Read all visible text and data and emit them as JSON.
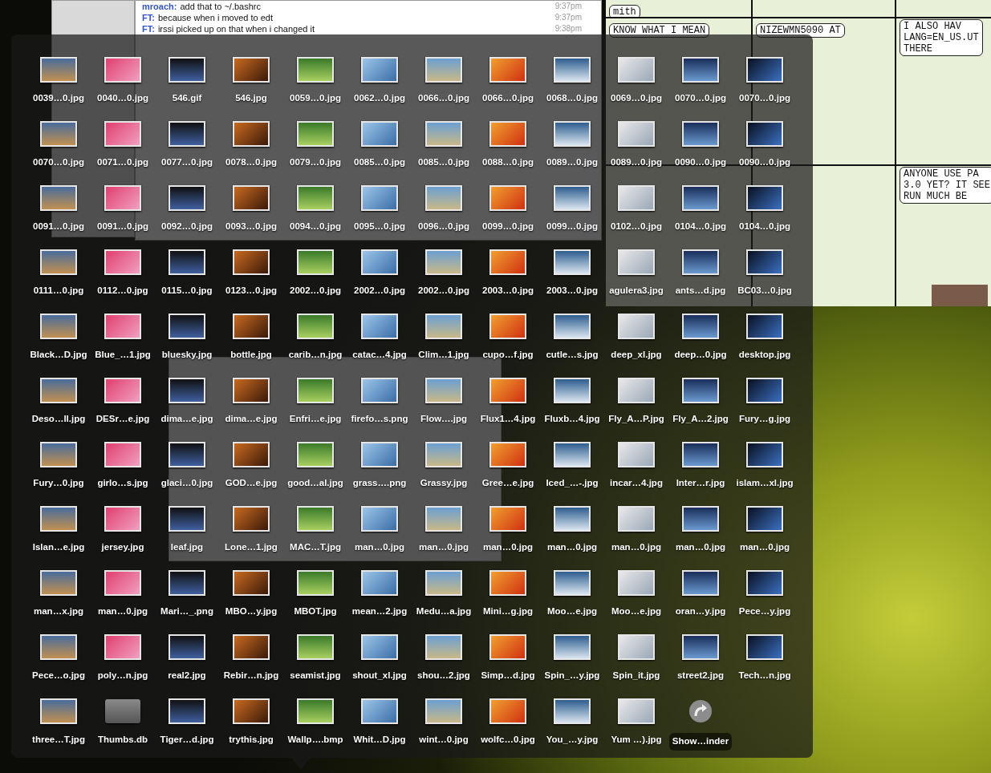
{
  "chat_window": {
    "lines": [
      {
        "nick": "mroach:",
        "text": "add that to ~/.bashrc",
        "time": "9:37pm"
      },
      {
        "nick": "FT:",
        "text": "because when i moved to edt",
        "time": "9:37pm"
      },
      {
        "nick": "FT:",
        "text": "irssi picked up on that when i changed it",
        "time": "9:38pm"
      }
    ]
  },
  "comic": {
    "bubbles": [
      {
        "lines": [
          "mith"
        ]
      },
      {
        "lines": [
          "KNOW WHAT I MEAN"
        ]
      },
      {
        "lines": [
          "NIZEWMN5090 AT"
        ]
      },
      {
        "lines": [
          "I ALSO HAV",
          "LANG=EN_US.UT",
          "THERE"
        ]
      },
      {
        "lines": [
          "ANYONE USE PA",
          "3.0 YET? IT SEE",
          "RUN MUCH BE"
        ]
      }
    ]
  },
  "stack": {
    "items": [
      {
        "label": "0039…0.jpg",
        "kind": "image"
      },
      {
        "label": "0040…0.jpg",
        "kind": "image"
      },
      {
        "label": "546.gif",
        "kind": "image"
      },
      {
        "label": "546.jpg",
        "kind": "image"
      },
      {
        "label": "0059…0.jpg",
        "kind": "image"
      },
      {
        "label": "0062…0.jpg",
        "kind": "image"
      },
      {
        "label": "0066…0.jpg",
        "kind": "image"
      },
      {
        "label": "0066…0.jpg",
        "kind": "image"
      },
      {
        "label": "0068…0.jpg",
        "kind": "image"
      },
      {
        "label": "0069…0.jpg",
        "kind": "image"
      },
      {
        "label": "0070…0.jpg",
        "kind": "image"
      },
      {
        "label": "0070…0.jpg",
        "kind": "image"
      },
      {
        "label": "0070…0.jpg",
        "kind": "image"
      },
      {
        "label": "0071…0.jpg",
        "kind": "image"
      },
      {
        "label": "0077…0.jpg",
        "kind": "image"
      },
      {
        "label": "0078…0.jpg",
        "kind": "image"
      },
      {
        "label": "0079…0.jpg",
        "kind": "image"
      },
      {
        "label": "0085…0.jpg",
        "kind": "image"
      },
      {
        "label": "0085…0.jpg",
        "kind": "image"
      },
      {
        "label": "0088…0.jpg",
        "kind": "image"
      },
      {
        "label": "0089…0.jpg",
        "kind": "image"
      },
      {
        "label": "0089…0.jpg",
        "kind": "image"
      },
      {
        "label": "0090…0.jpg",
        "kind": "image"
      },
      {
        "label": "0090…0.jpg",
        "kind": "image"
      },
      {
        "label": "0091…0.jpg",
        "kind": "image"
      },
      {
        "label": "0091…0.jpg",
        "kind": "image"
      },
      {
        "label": "0092…0.jpg",
        "kind": "image"
      },
      {
        "label": "0093…0.jpg",
        "kind": "image"
      },
      {
        "label": "0094…0.jpg",
        "kind": "image"
      },
      {
        "label": "0095…0.jpg",
        "kind": "image"
      },
      {
        "label": "0096…0.jpg",
        "kind": "image"
      },
      {
        "label": "0099…0.jpg",
        "kind": "image"
      },
      {
        "label": "0099…0.jpg",
        "kind": "image"
      },
      {
        "label": "0102…0.jpg",
        "kind": "image"
      },
      {
        "label": "0104…0.jpg",
        "kind": "image"
      },
      {
        "label": "0104…0.jpg",
        "kind": "image"
      },
      {
        "label": "0111…0.jpg",
        "kind": "image"
      },
      {
        "label": "0112…0.jpg",
        "kind": "image"
      },
      {
        "label": "0115…0.jpg",
        "kind": "image"
      },
      {
        "label": "0123…0.jpg",
        "kind": "image"
      },
      {
        "label": "2002…0.jpg",
        "kind": "image"
      },
      {
        "label": "2002…0.jpg",
        "kind": "image"
      },
      {
        "label": "2002…0.jpg",
        "kind": "image"
      },
      {
        "label": "2003…0.jpg",
        "kind": "image"
      },
      {
        "label": "2003…0.jpg",
        "kind": "image"
      },
      {
        "label": "agulera3.jpg",
        "kind": "image"
      },
      {
        "label": "ants…d.jpg",
        "kind": "image"
      },
      {
        "label": "BC03…0.jpg",
        "kind": "image"
      },
      {
        "label": "Black…D.jpg",
        "kind": "image"
      },
      {
        "label": "Blue_…1.jpg",
        "kind": "image"
      },
      {
        "label": "bluesky.jpg",
        "kind": "image"
      },
      {
        "label": "bottle.jpg",
        "kind": "image"
      },
      {
        "label": "carib…n.jpg",
        "kind": "image"
      },
      {
        "label": "catac…4.jpg",
        "kind": "image"
      },
      {
        "label": "Clim…1.jpg",
        "kind": "image"
      },
      {
        "label": "cupo…f.jpg",
        "kind": "image"
      },
      {
        "label": "cutle…s.jpg",
        "kind": "image"
      },
      {
        "label": "deep_xl.jpg",
        "kind": "image"
      },
      {
        "label": "deep…0.jpg",
        "kind": "image"
      },
      {
        "label": "desktop.jpg",
        "kind": "image"
      },
      {
        "label": "Deso…ll.jpg",
        "kind": "image"
      },
      {
        "label": "DESr…e.jpg",
        "kind": "image"
      },
      {
        "label": "dima…e.jpg",
        "kind": "image"
      },
      {
        "label": "dima…e.jpg",
        "kind": "image"
      },
      {
        "label": "Enfri…e.jpg",
        "kind": "image"
      },
      {
        "label": "firefo…s.png",
        "kind": "image"
      },
      {
        "label": "Flow….jpg",
        "kind": "image"
      },
      {
        "label": "Flux1…4.jpg",
        "kind": "image"
      },
      {
        "label": "Fluxb…4.jpg",
        "kind": "image"
      },
      {
        "label": "Fly_A…P.jpg",
        "kind": "image"
      },
      {
        "label": "Fly_A…2.jpg",
        "kind": "image"
      },
      {
        "label": "Fury…g.jpg",
        "kind": "image"
      },
      {
        "label": "Fury…0.jpg",
        "kind": "image"
      },
      {
        "label": "girlo…s.jpg",
        "kind": "image"
      },
      {
        "label": "glaci…0.jpg",
        "kind": "image"
      },
      {
        "label": "GOD…e.jpg",
        "kind": "image"
      },
      {
        "label": "good…al.jpg",
        "kind": "image"
      },
      {
        "label": "grass….png",
        "kind": "image"
      },
      {
        "label": "Grassy.jpg",
        "kind": "image"
      },
      {
        "label": "Gree…e.jpg",
        "kind": "image"
      },
      {
        "label": "Iced_…-.jpg",
        "kind": "image"
      },
      {
        "label": "incar…4.jpg",
        "kind": "image"
      },
      {
        "label": "Inter…r.jpg",
        "kind": "image"
      },
      {
        "label": "islam…xl.jpg",
        "kind": "image"
      },
      {
        "label": "Islan…e.jpg",
        "kind": "image"
      },
      {
        "label": "jersey.jpg",
        "kind": "image"
      },
      {
        "label": "leaf.jpg",
        "kind": "image"
      },
      {
        "label": "Lone…1.jpg",
        "kind": "image"
      },
      {
        "label": "MAC…T.jpg",
        "kind": "image"
      },
      {
        "label": "man…0.jpg",
        "kind": "image"
      },
      {
        "label": "man…0.jpg",
        "kind": "image"
      },
      {
        "label": "man…0.jpg",
        "kind": "image"
      },
      {
        "label": "man…0.jpg",
        "kind": "image"
      },
      {
        "label": "man…0.jpg",
        "kind": "image"
      },
      {
        "label": "man…0.jpg",
        "kind": "image"
      },
      {
        "label": "man…0.jpg",
        "kind": "image"
      },
      {
        "label": "man…x.jpg",
        "kind": "image"
      },
      {
        "label": "man…0.jpg",
        "kind": "image"
      },
      {
        "label": "Mari…_.png",
        "kind": "image"
      },
      {
        "label": "MBO…y.jpg",
        "kind": "image"
      },
      {
        "label": "MBOT.jpg",
        "kind": "image"
      },
      {
        "label": "mean…2.jpg",
        "kind": "image"
      },
      {
        "label": "Medu…a.jpg",
        "kind": "image"
      },
      {
        "label": "Mini…g.jpg",
        "kind": "image"
      },
      {
        "label": "Moo…e.jpg",
        "kind": "image"
      },
      {
        "label": "Moo…e.jpg",
        "kind": "image"
      },
      {
        "label": "oran…y.jpg",
        "kind": "image"
      },
      {
        "label": "Pece…y.jpg",
        "kind": "image"
      },
      {
        "label": "Pece…o.jpg",
        "kind": "image"
      },
      {
        "label": "poly…n.jpg",
        "kind": "image"
      },
      {
        "label": "real2.jpg",
        "kind": "image"
      },
      {
        "label": "Rebir…n.jpg",
        "kind": "image"
      },
      {
        "label": "seamist.jpg",
        "kind": "image"
      },
      {
        "label": "shout_xl.jpg",
        "kind": "image"
      },
      {
        "label": "shou…2.jpg",
        "kind": "image"
      },
      {
        "label": "Simp…d.jpg",
        "kind": "image"
      },
      {
        "label": "Spin_…y.jpg",
        "kind": "image"
      },
      {
        "label": "Spin_it.jpg",
        "kind": "image"
      },
      {
        "label": "street2.jpg",
        "kind": "image"
      },
      {
        "label": "Tech…n.jpg",
        "kind": "image"
      },
      {
        "label": "three…T.jpg",
        "kind": "image"
      },
      {
        "label": "Thumbs.db",
        "kind": "document"
      },
      {
        "label": "Tiger…d.jpg",
        "kind": "image"
      },
      {
        "label": "trythis.jpg",
        "kind": "image"
      },
      {
        "label": "Wallp….bmp",
        "kind": "image"
      },
      {
        "label": "Whit…D.jpg",
        "kind": "image"
      },
      {
        "label": "wint…0.jpg",
        "kind": "image"
      },
      {
        "label": "wolfc…0.jpg",
        "kind": "image"
      },
      {
        "label": "You_…y.jpg",
        "kind": "image"
      },
      {
        "label": "Yum …).jpg",
        "kind": "image"
      },
      {
        "label": "Show…inder",
        "kind": "finder"
      }
    ]
  }
}
